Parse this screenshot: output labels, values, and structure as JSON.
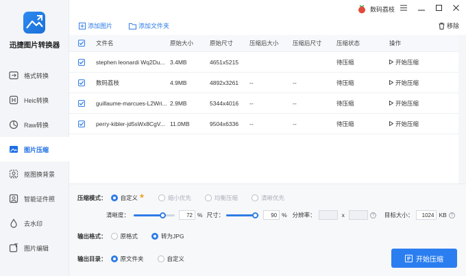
{
  "app": {
    "name": "迅捷图片转换器"
  },
  "sidebar": {
    "items": [
      {
        "label": "格式转换",
        "icon": "image-convert-icon",
        "active": false
      },
      {
        "label": "Heic转换",
        "icon": "heic-icon",
        "active": false
      },
      {
        "label": "Raw转换",
        "icon": "raw-camera-icon",
        "active": false
      },
      {
        "label": "图片压缩",
        "icon": "image-compress-icon",
        "active": true
      },
      {
        "label": "抠图换背景",
        "icon": "cutout-icon",
        "active": false
      },
      {
        "label": "智能证件照",
        "icon": "id-photo-icon",
        "active": false
      },
      {
        "label": "去水印",
        "icon": "watermark-remove-icon",
        "active": false
      },
      {
        "label": "图片编辑",
        "icon": "image-edit-icon",
        "active": false
      }
    ]
  },
  "titlebar": {
    "username": "数码荔枝"
  },
  "toolbar": {
    "add_image": "添加图片",
    "add_folder": "添加文件夹",
    "remove": "移除"
  },
  "table": {
    "headers": [
      "文件名",
      "原始大小",
      "原始尺寸",
      "压缩后大小",
      "压缩后尺寸",
      "压缩状态",
      "操作"
    ],
    "rows": [
      {
        "name": "stephen leonardi Wq2Du...",
        "size": "3.4MB",
        "dims": "4651x5215",
        "new_size": "",
        "new_dims": "",
        "status": "待压缩",
        "action": "开始压缩"
      },
      {
        "name": "数码荔枝",
        "size": "4.9MB",
        "dims": "4892x3261",
        "new_size": "--",
        "new_dims": "--",
        "status": "待压缩",
        "action": "开始压缩"
      },
      {
        "name": "guillaume-marcues-L2Wri...",
        "size": "2.9MB",
        "dims": "5344x4016",
        "new_size": "--",
        "new_dims": "--",
        "status": "待压缩",
        "action": "开始压缩"
      },
      {
        "name": "perry-kibler-jd5sWx8CgV...",
        "size": "11.0MB",
        "dims": "9504x6336",
        "new_size": "--",
        "new_dims": "--",
        "status": "待压缩",
        "action": "开始压缩"
      }
    ]
  },
  "settings": {
    "mode_label": "压缩模式：",
    "modes": [
      "自定义",
      "缩小优先",
      "均衡压缩",
      "清晰优先"
    ],
    "clarity_label": "清晰度：",
    "clarity_value": "72",
    "clarity_level": 0.72,
    "percent": "%",
    "size_label": "尺寸：",
    "size_value": "90",
    "size_level": 0.9,
    "resolution_label": "分辨率：",
    "x_sep": "x",
    "target_label": "目标大小：",
    "target_value": "1024",
    "target_unit": "KB",
    "output_format_label": "输出格式：",
    "formats": [
      "原格式",
      "转为JPG"
    ],
    "output_dir_label": "输出目录：",
    "dirs": [
      "原文件夹",
      "自定义"
    ],
    "start_button": "开始压缩",
    "qmark": "?"
  },
  "colors": {
    "accent": "#2b7ef0",
    "sidebar_bg": "#f3f5f8"
  }
}
